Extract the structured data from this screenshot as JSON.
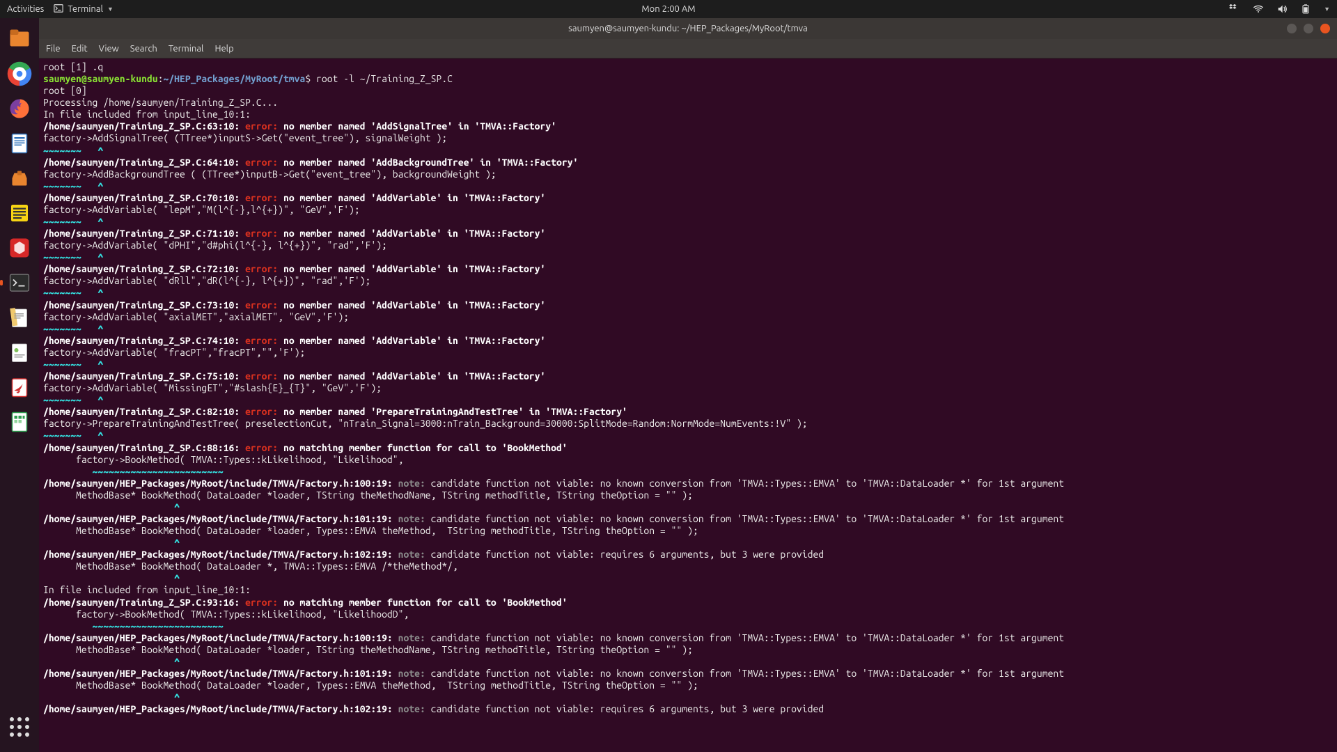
{
  "topbar": {
    "activities": "Activities",
    "app_icon_label": "Terminal",
    "clock": "Mon  2:00 AM"
  },
  "window": {
    "title": "saumyen@saumyen-kundu: ~/HEP_Packages/MyRoot/tmva"
  },
  "menubar": {
    "file": "File",
    "edit": "Edit",
    "view": "View",
    "search": "Search",
    "terminal": "Terminal",
    "help": "Help"
  },
  "prompt": {
    "user_host": "saumyen@saumyen-kundu",
    "colon": ":",
    "path_prefix": "~",
    "path": "/HEP_Packages/MyRoot/tmva",
    "dollar": "$ ",
    "command": "root -l ~/Training_Z_SP.C"
  },
  "term": {
    "l0": "root [1] .q",
    "l2": "root [0]",
    "l3": "Processing /home/saumyen/Training_Z_SP.C...",
    "l4": "In file included from input_line_10:1:",
    "tilde": "~~~~~~~   ^",
    "tilde2": "         ~~~~~~~~~~~~~~~~~~~~~~~~",
    "caret": "                        ^",
    "err_label": "error: ",
    "note_label": "note: ",
    "e1_loc": "/home/saumyen/Training_Z_SP.C:63:10: ",
    "e1_msg": "no member named 'AddSignalTree' in 'TMVA::Factory'",
    "e1_src": "factory->AddSignalTree( (TTree*)inputS->Get(\"event_tree\"), signalWeight );",
    "e2_loc": "/home/saumyen/Training_Z_SP.C:64:10: ",
    "e2_msg": "no member named 'AddBackgroundTree' in 'TMVA::Factory'",
    "e2_src": "factory->AddBackgroundTree ( (TTree*)inputB->Get(\"event_tree\"), backgroundWeight );",
    "e3_loc": "/home/saumyen/Training_Z_SP.C:70:10: ",
    "e3_msg": "no member named 'AddVariable' in 'TMVA::Factory'",
    "e3_src": "factory->AddVariable( \"lepM\",\"M(l^{-},l^{+})\", \"GeV\",'F');",
    "e4_loc": "/home/saumyen/Training_Z_SP.C:71:10: ",
    "e4_msg": "no member named 'AddVariable' in 'TMVA::Factory'",
    "e4_src": "factory->AddVariable( \"dPHI\",\"d#phi(l^{-}, l^{+})\", \"rad\",'F');",
    "e5_loc": "/home/saumyen/Training_Z_SP.C:72:10: ",
    "e5_msg": "no member named 'AddVariable' in 'TMVA::Factory'",
    "e5_src": "factory->AddVariable( \"dRll\",\"dR(l^{-}, l^{+})\", \"rad\",'F');",
    "e6_loc": "/home/saumyen/Training_Z_SP.C:73:10: ",
    "e6_msg": "no member named 'AddVariable' in 'TMVA::Factory'",
    "e6_src": "factory->AddVariable( \"axialMET\",\"axialMET\", \"GeV\",'F');",
    "e7_loc": "/home/saumyen/Training_Z_SP.C:74:10: ",
    "e7_msg": "no member named 'AddVariable' in 'TMVA::Factory'",
    "e7_src": "factory->AddVariable( \"fracPT\",\"fracPT\",\"\",'F');",
    "e8_loc": "/home/saumyen/Training_Z_SP.C:75:10: ",
    "e8_msg": "no member named 'AddVariable' in 'TMVA::Factory'",
    "e8_src": "factory->AddVariable( \"MissingET\",\"#slash{E}_{T}\", \"GeV\",'F');",
    "e9_loc": "/home/saumyen/Training_Z_SP.C:82:10: ",
    "e9_msg": "no member named 'PrepareTrainingAndTestTree' in 'TMVA::Factory'",
    "e9_src": "factory->PrepareTrainingAndTestTree( preselectionCut, \"nTrain_Signal=3000:nTrain_Background=30000:SplitMode=Random:NormMode=NumEvents:!V\" );",
    "e10_loc": "/home/saumyen/Training_Z_SP.C:88:16: ",
    "e10_msg": "no matching member function for call to 'BookMethod'",
    "e10_src": "      factory->BookMethod( TMVA::Types::kLikelihood, \"Likelihood\",",
    "n1_loc": "/home/saumyen/HEP_Packages/MyRoot/include/TMVA/Factory.h:100:19: ",
    "n1_msg": "candidate function not viable: no known conversion from 'TMVA::Types::EMVA' to 'TMVA::DataLoader *' for 1st argument",
    "n1_src": "      MethodBase* BookMethod( DataLoader *loader, TString theMethodName, TString methodTitle, TString theOption = \"\" );",
    "n2_loc": "/home/saumyen/HEP_Packages/MyRoot/include/TMVA/Factory.h:101:19: ",
    "n2_msg": "candidate function not viable: no known conversion from 'TMVA::Types::EMVA' to 'TMVA::DataLoader *' for 1st argument",
    "n2_src": "      MethodBase* BookMethod( DataLoader *loader, Types::EMVA theMethod,  TString methodTitle, TString theOption = \"\" );",
    "n3_loc": "/home/saumyen/HEP_Packages/MyRoot/include/TMVA/Factory.h:102:19: ",
    "n3_msg": "candidate function not viable: requires 6 arguments, but 3 were provided",
    "n3_src": "      MethodBase* BookMethod( DataLoader *, TMVA::Types::EMVA /*theMethod*/,",
    "incl": "In file included from input_line_10:1:",
    "e11_loc": "/home/saumyen/Training_Z_SP.C:93:16: ",
    "e11_msg": "no matching member function for call to 'BookMethod'",
    "e11_src": "      factory->BookMethod( TMVA::Types::kLikelihood, \"LikelihoodD\","
  }
}
